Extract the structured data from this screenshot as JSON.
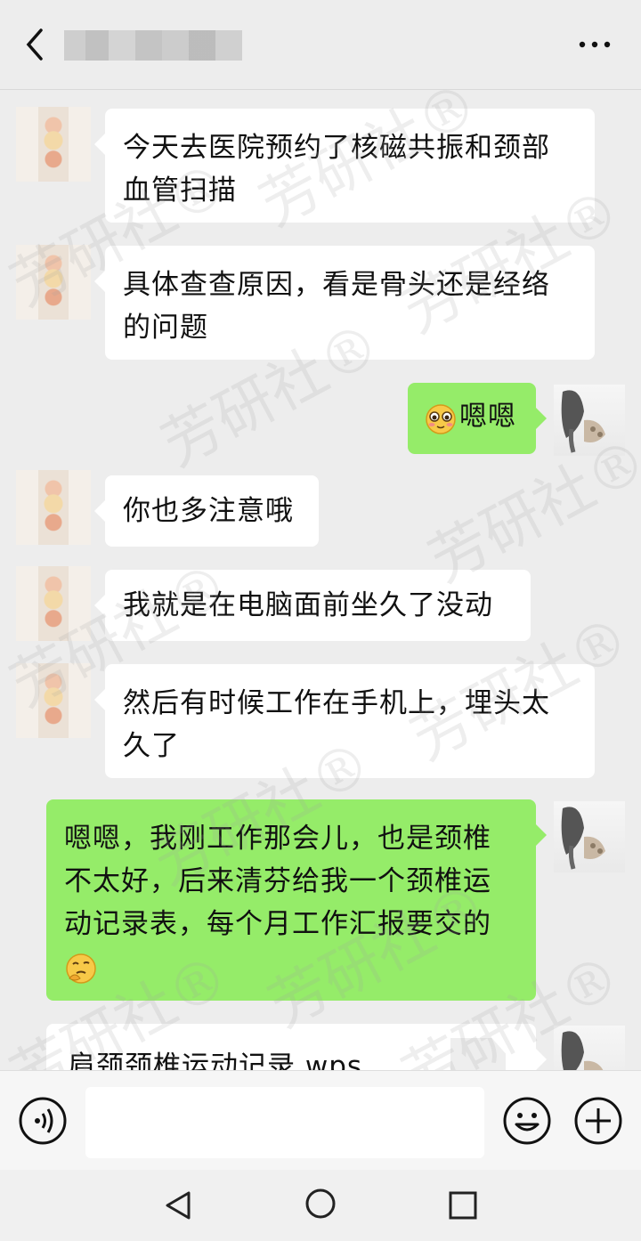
{
  "header": {
    "title": "",
    "more_label": "..."
  },
  "messages": [
    {
      "side": "in",
      "text": "今天去医院预约了核磁共振和颈部血管扫描"
    },
    {
      "side": "in",
      "text": "具体查查原因，看是骨头还是经络的问题"
    },
    {
      "side": "out",
      "emoji": "blush-face",
      "text": "嗯嗯"
    },
    {
      "side": "in",
      "text": "你也多注意哦"
    },
    {
      "side": "in",
      "text": "我就是在电脑面前坐久了没动"
    },
    {
      "side": "in",
      "text": "然后有时候工作在手机上，埋头太久了"
    },
    {
      "side": "out",
      "text": "嗯嗯，我刚工作那会儿，也是颈椎不太好，后来清芬给我一个颈椎运动记录表，每个月工作汇报要交的",
      "emoji": "thinking-face"
    },
    {
      "side": "out",
      "type": "file",
      "text": "肩颈颈椎运动记录.wps"
    }
  ],
  "watermark": {
    "text": "芳研社®"
  },
  "input_bar": {
    "placeholder": ""
  },
  "colors": {
    "outgoing_bubble": "#95ec69",
    "incoming_bubble": "#ffffff",
    "background": "#ededed"
  },
  "icons": {
    "back": "chevron-left-icon",
    "more": "more-dots-icon",
    "voice": "voice-icon",
    "emoji": "smiley-icon",
    "plus": "plus-icon"
  }
}
